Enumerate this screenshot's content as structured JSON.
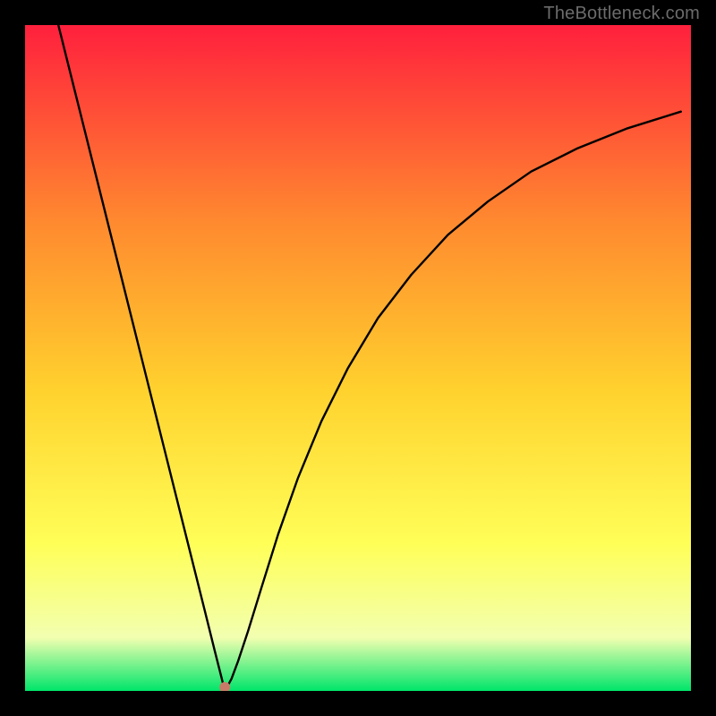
{
  "watermark": "TheBottleneck.com",
  "chart_data": {
    "type": "line",
    "title": "",
    "xlabel": "",
    "ylabel": "",
    "xlim": [
      0,
      1
    ],
    "ylim": [
      0,
      1
    ],
    "grid": false,
    "legend": false,
    "annotations": [],
    "background_gradient": {
      "top": "#ff203d",
      "mid_upper": "#ff8b2f",
      "mid": "#ffd22e",
      "mid_lower": "#ffff58",
      "lower": "#f2ffb0",
      "bottom": "#00e56a"
    },
    "marker": {
      "x": 0.3,
      "y": 0.0,
      "color": "#c77a67"
    },
    "series": [
      {
        "name": "curve",
        "x": [
          0.05,
          0.075,
          0.1,
          0.125,
          0.15,
          0.175,
          0.2,
          0.225,
          0.25,
          0.27,
          0.285,
          0.295,
          0.3,
          0.31,
          0.32,
          0.335,
          0.355,
          0.38,
          0.41,
          0.445,
          0.485,
          0.53,
          0.58,
          0.635,
          0.695,
          0.76,
          0.83,
          0.905,
          0.985
        ],
        "y": [
          1.0,
          0.9,
          0.8,
          0.7,
          0.6,
          0.5,
          0.4,
          0.3,
          0.2,
          0.12,
          0.06,
          0.02,
          0.0,
          0.018,
          0.045,
          0.09,
          0.155,
          0.235,
          0.32,
          0.405,
          0.485,
          0.56,
          0.625,
          0.685,
          0.735,
          0.78,
          0.815,
          0.845,
          0.87
        ]
      }
    ]
  }
}
